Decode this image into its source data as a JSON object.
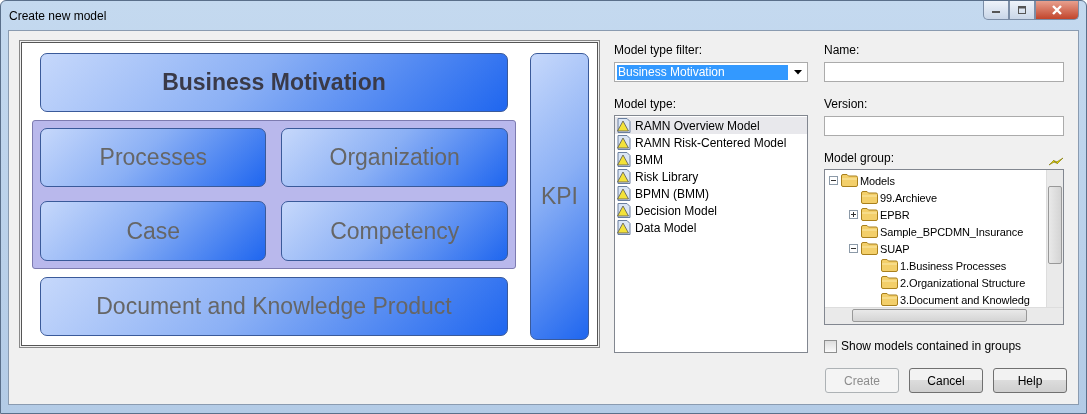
{
  "window": {
    "title": "Create new model"
  },
  "preview": {
    "header": "Business Motivation",
    "group_tiles": [
      "Processes",
      "Organization",
      "Case",
      "Competency"
    ],
    "footer": "Document and Knowledge Product",
    "side": "KPI"
  },
  "filter": {
    "label": "Model type filter:",
    "value": "Business Motivation"
  },
  "model_types": {
    "label": "Model type:",
    "items": [
      {
        "label": "RAMN Overview Model",
        "selected": true
      },
      {
        "label": "RAMN Risk-Centered Model",
        "selected": false
      },
      {
        "label": "BMM",
        "selected": false
      },
      {
        "label": "Risk Library",
        "selected": false
      },
      {
        "label": "BPMN (BMM)",
        "selected": false
      },
      {
        "label": "Decision Model",
        "selected": false
      },
      {
        "label": "Data Model",
        "selected": false
      }
    ]
  },
  "name": {
    "label": "Name:"
  },
  "version": {
    "label": "Version:"
  },
  "model_group": {
    "label": "Model group:",
    "tree": [
      {
        "label": "Models",
        "expanded": true,
        "children": [
          {
            "label": "99.Archieve"
          },
          {
            "label": "EPBR",
            "expanded": false
          },
          {
            "label": "Sample_BPCDMN_Insurance"
          },
          {
            "label": "SUAP",
            "expanded": true,
            "children": [
              {
                "label": "1.Business Processes"
              },
              {
                "label": "2.Organizational Structure"
              },
              {
                "label": "3.Document and Knowledg"
              }
            ]
          }
        ]
      }
    ]
  },
  "show_in_groups": {
    "label": "Show models contained in groups",
    "checked": false
  },
  "buttons": [
    {
      "label": "Create",
      "disabled": true
    },
    {
      "label": "Cancel",
      "disabled": false
    },
    {
      "label": "Help",
      "disabled": false
    }
  ]
}
